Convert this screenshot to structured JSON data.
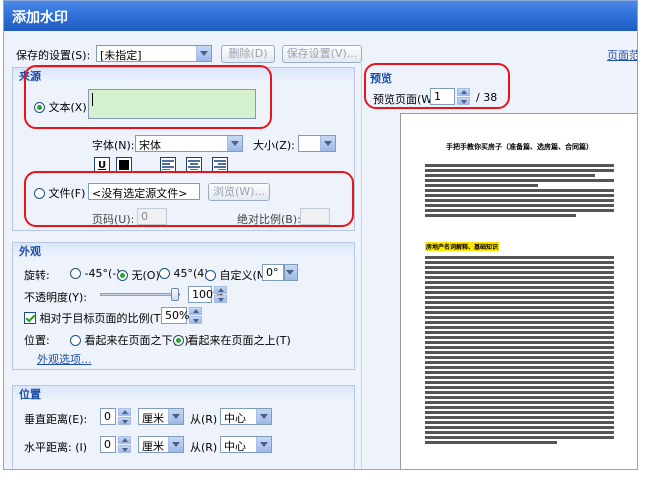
{
  "window": {
    "title": "添加水印"
  },
  "top": {
    "saved_settings_label": "保存的设置(S):",
    "saved_settings_value": "[未指定]",
    "delete_label": "删除(D)",
    "save_settings_label": "保存设置(V)...",
    "page_range_link": "页面范"
  },
  "source": {
    "header": "来源",
    "text_radio_label": "文本(X)",
    "text_value": "",
    "font_label": "字体(N):",
    "font_value": "宋体",
    "size_label": "大小(Z):",
    "size_value": "",
    "underline_label": "U",
    "file_radio_label": "文件(F)",
    "file_value": "<没有选定源文件>",
    "browse_label": "浏览(W)...",
    "page_number_label": "页码(U):",
    "page_number_value": "0",
    "absolute_scale_label": "绝对比例(B):",
    "absolute_scale_value": ""
  },
  "appearance": {
    "header": "外观",
    "rotation_label": "旋转:",
    "rot_minus45": "-45°(-)",
    "rot_none": "无(O)",
    "rot_45": "45°(4)",
    "rot_custom": "自定义(M)",
    "rot_value": "0°",
    "opacity_label": "不透明度(Y):",
    "opacity_value": "100%",
    "opacity_fraction": 1.0,
    "relative_scale_label": "相对于目标页面的比例(T)",
    "relative_scale_value": "50%",
    "position_label": "位置:",
    "pos_behind": "看起来在页面之下(B)",
    "pos_front": "看起来在页面之上(T)",
    "appearance_options_link": "外观选项..."
  },
  "position": {
    "header": "位置",
    "vertical_label": "垂直距离(E):",
    "vertical_value": "0",
    "vertical_unit": "厘米",
    "vertical_from_label": "从(R)",
    "vertical_from_value": "中心",
    "horizontal_label": "水平距离: (I)",
    "horizontal_value": "0",
    "horizontal_unit": "厘米",
    "horizontal_from_label": "从(R)",
    "horizontal_from_value": "中心"
  },
  "preview": {
    "header": "预览",
    "page_label": "预览页面(W)",
    "page_value": "1",
    "page_total": "/ 38",
    "doc_title": "手把手教你买房子（准备篇、选房篇、合同篇）",
    "doc_section": "房地产名词解释、基础知识"
  },
  "colors": {
    "title_bar": "#2f6fd6",
    "text_field_bg": "#d4f0cf",
    "highlight_red": "#e8131b",
    "link": "#1e4fa8"
  }
}
